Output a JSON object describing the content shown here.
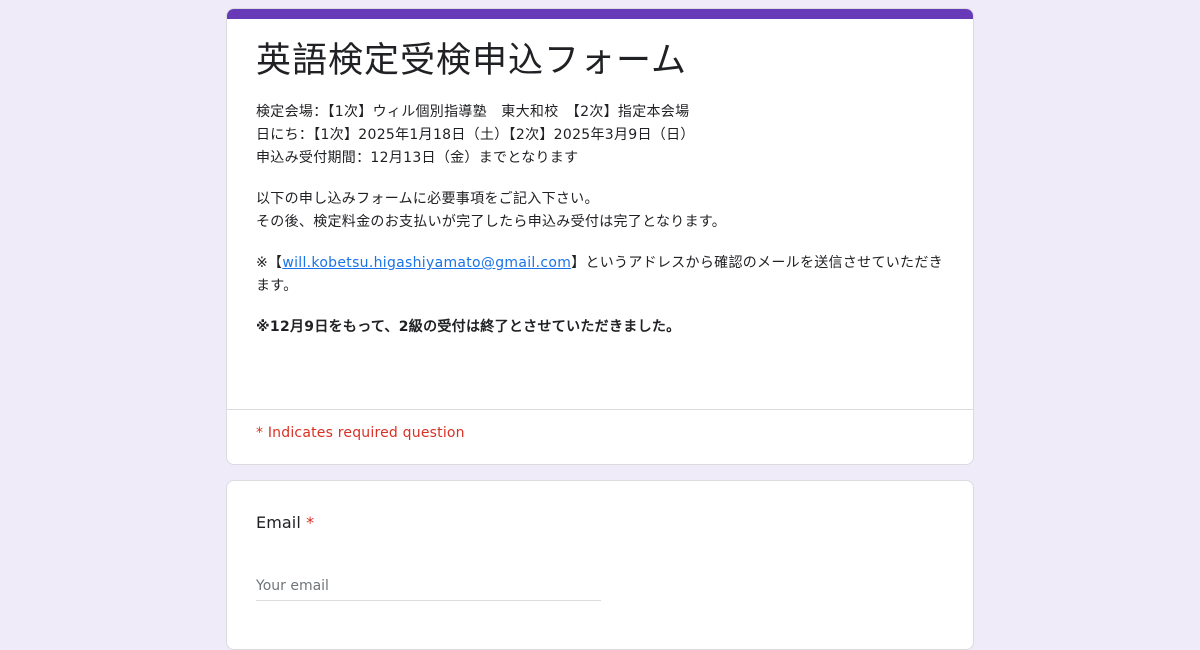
{
  "form": {
    "title": "英語検定受検申込フォーム",
    "description": {
      "line1": "検定会場：【1次】ウィル個別指導塾　東大和校　【2次】指定本会場",
      "line2": "日にち：【1次】2025年1月18日（土）【2次】2025年3月9日（日）",
      "line3": "申込み受付期間：12月13日（金）までとなります",
      "line4": "以下の申し込みフォームに必要事項をご記入下さい。",
      "line5": "その後、検定料金のお支払いが完了したら申込み受付は完了となります。",
      "email_prefix": "※【",
      "email_link": "will.kobetsu.higashiyamato@gmail.com",
      "email_suffix": "】というアドレスから確認のメールを送信させていただきます。",
      "notice": "※12月9日をもって、2級の受付は終了とさせていただきました。"
    },
    "required_note": "* Indicates required question"
  },
  "email_question": {
    "label": "Email",
    "required_star": "*",
    "placeholder": "Your email"
  },
  "colors": {
    "accent": "#673ab7",
    "background": "#f0ebf8",
    "required": "#d93025",
    "link": "#1a73e8"
  }
}
